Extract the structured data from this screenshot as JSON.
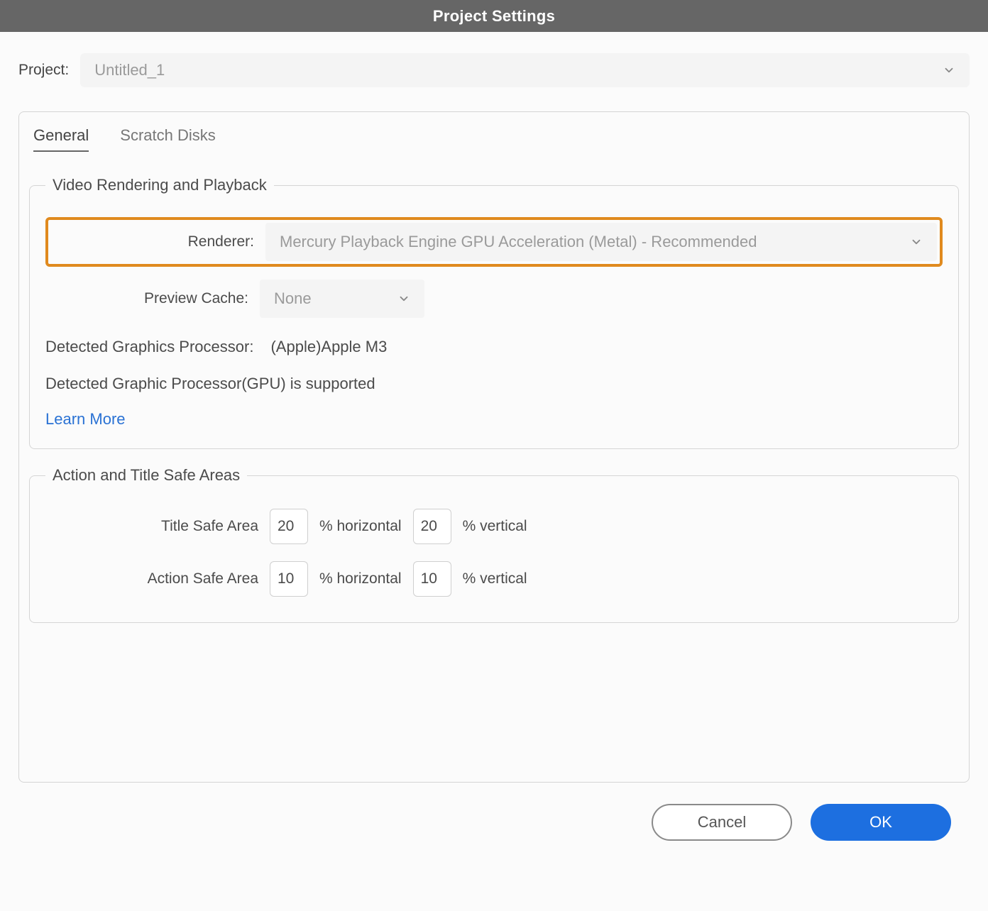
{
  "title": "Project Settings",
  "project": {
    "label": "Project:",
    "value": "Untitled_1"
  },
  "tabs": {
    "general": "General",
    "scratch": "Scratch Disks"
  },
  "rendering": {
    "legend": "Video Rendering and Playback",
    "renderer_label": "Renderer:",
    "renderer_value": "Mercury Playback Engine GPU Acceleration (Metal) - Recommended",
    "cache_label": "Preview Cache:",
    "cache_value": "None",
    "detected_label": "Detected Graphics Processor:",
    "detected_value": "(Apple)Apple M3",
    "support_line": "Detected Graphic Processor(GPU) is supported",
    "learn_more": "Learn More"
  },
  "areas": {
    "legend": "Action and Title Safe Areas",
    "title_label": "Title Safe Area",
    "title_h": "20",
    "title_v": "20",
    "action_label": "Action Safe Area",
    "action_h": "10",
    "action_v": "10",
    "pct_horizontal": "% horizontal",
    "pct_vertical": "% vertical"
  },
  "buttons": {
    "cancel": "Cancel",
    "ok": "OK"
  }
}
